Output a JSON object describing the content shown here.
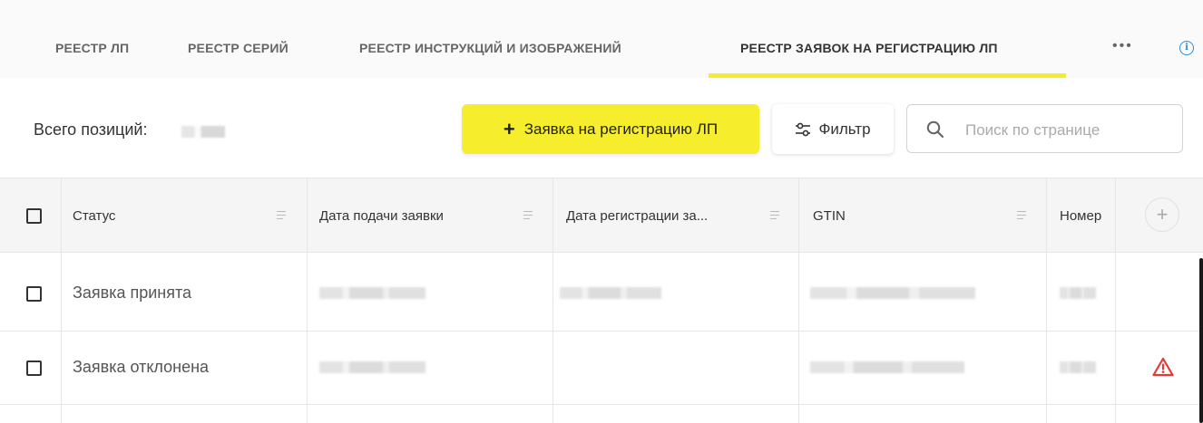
{
  "tabs": [
    {
      "label": "РЕЕСТР ЛП"
    },
    {
      "label": "РЕЕСТР СЕРИЙ"
    },
    {
      "label": "РЕЕСТР ИНСТРУКЦИЙ И ИЗОБРАЖЕНИЙ"
    },
    {
      "label": "РЕЕСТР ЗАЯВОК НА РЕГИСТРАЦИЮ ЛП"
    }
  ],
  "active_tab": "РЕЕСТР ЗАЯВОК НА РЕГИСТРАЦИЮ ЛП",
  "more_label": "•••",
  "info_icon": "info-icon",
  "toolbar": {
    "count_label": "Всего позиций:",
    "add_button_plus": "+",
    "add_button_label": "Заявка на регистрацию ЛП",
    "filter_label": "Фильтр",
    "search_placeholder": "Поиск по странице"
  },
  "table": {
    "columns": [
      {
        "label": "Статус"
      },
      {
        "label": "Дата подачи заявки"
      },
      {
        "label": "Дата регистрации за..."
      },
      {
        "label": "GTIN"
      },
      {
        "label": "Номер"
      }
    ],
    "add_column_label": "+",
    "rows": [
      {
        "status": "Заявка принята",
        "warning": false
      },
      {
        "status": "Заявка отклонена",
        "warning": true
      }
    ]
  },
  "colors": {
    "accent": "#f6ed2d",
    "info": "#2c8bd8",
    "warning": "#e53935"
  }
}
